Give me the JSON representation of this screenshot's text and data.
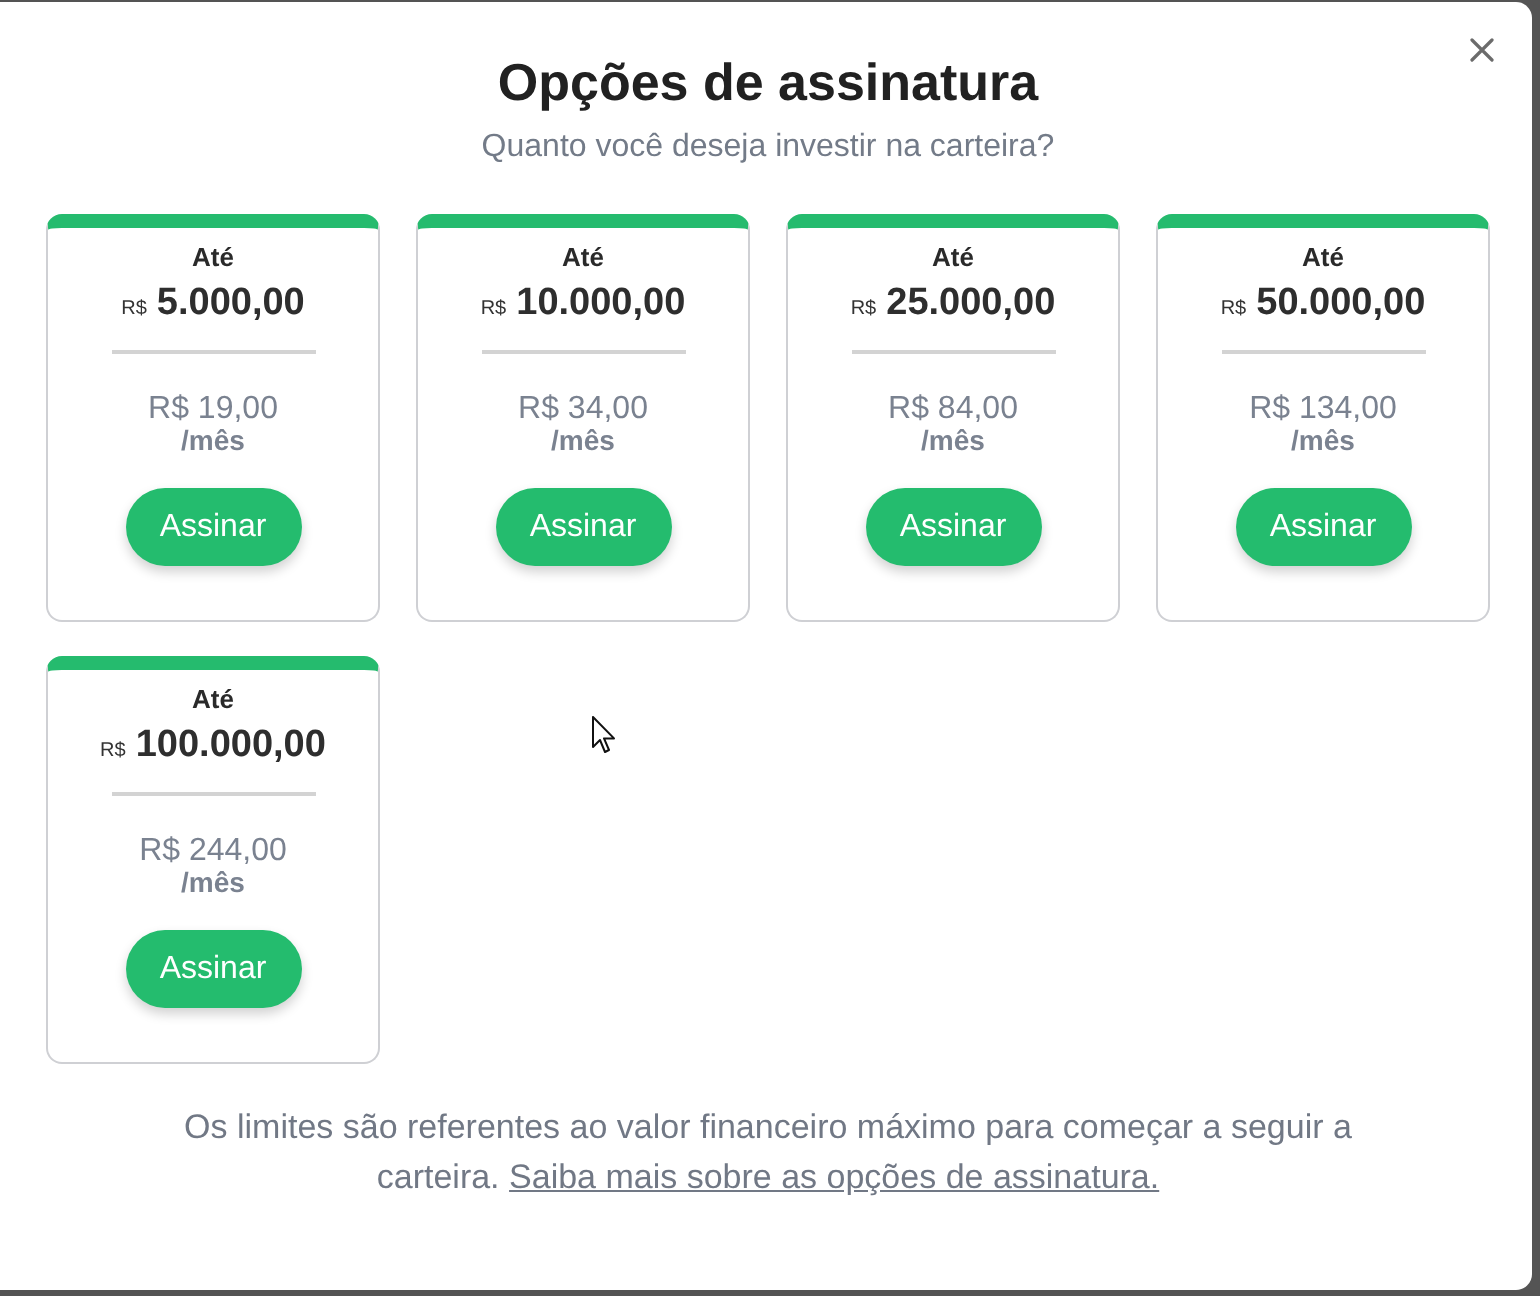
{
  "dialog": {
    "title": "Opções de assinatura",
    "subtitle": "Quanto você deseja investir na carteira?"
  },
  "plans": [
    {
      "prefix": "Até",
      "currency": "R$",
      "limit": "5.000,00",
      "price": "R$ 19,00",
      "period": "/mês",
      "button": "Assinar"
    },
    {
      "prefix": "Até",
      "currency": "R$",
      "limit": "10.000,00",
      "price": "R$ 34,00",
      "period": "/mês",
      "button": "Assinar"
    },
    {
      "prefix": "Até",
      "currency": "R$",
      "limit": "25.000,00",
      "price": "R$ 84,00",
      "period": "/mês",
      "button": "Assinar"
    },
    {
      "prefix": "Até",
      "currency": "R$",
      "limit": "50.000,00",
      "price": "R$ 134,00",
      "period": "/mês",
      "button": "Assinar"
    },
    {
      "prefix": "Até",
      "currency": "R$",
      "limit": "100.000,00",
      "price": "R$ 244,00",
      "period": "/mês",
      "button": "Assinar"
    }
  ],
  "footer": {
    "text": "Os limites são referentes ao valor financeiro máximo para começar a seguir a carteira.",
    "link": "Saiba mais sobre as opções de assinatura."
  }
}
